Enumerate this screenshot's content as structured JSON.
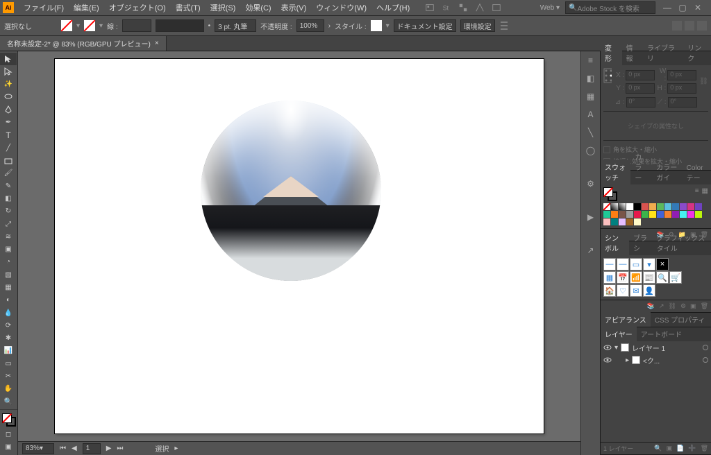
{
  "app": {
    "icon_label": "Ai",
    "menus": [
      "ファイル(F)",
      "編集(E)",
      "オブジェクト(O)",
      "書式(T)",
      "選択(S)",
      "効果(C)",
      "表示(V)",
      "ウィンドウ(W)",
      "ヘルプ(H)"
    ],
    "workspace": "Web",
    "search_placeholder": "Adobe Stock を検索"
  },
  "control": {
    "selection_label": "選択なし",
    "stroke_label": "線 :",
    "stroke_weight": "",
    "stroke_preset": "3 pt. 丸筆",
    "opacity_label": "不透明度 :",
    "opacity_value": "100%",
    "style_label": "スタイル :",
    "doc_setup": "ドキュメント設定",
    "env_setup": "環境設定"
  },
  "tab": {
    "title": "名称未設定-2* @ 83% (RGB/GPU プレビュー)"
  },
  "status": {
    "zoom": "83%",
    "page": "1",
    "tool": "選択"
  },
  "panels": {
    "transform": {
      "tabs": [
        "変形",
        "情報",
        "ライブラリ",
        "リンク"
      ],
      "x_label": "X :",
      "x": "0 px",
      "y_label": "Y :",
      "y": "0 px",
      "w_label": "W :",
      "w": "0 px",
      "h_label": "H :",
      "h": "0 px",
      "angle_label": "⊿ :",
      "angle": "0°",
      "shear_label": "⟋ :",
      "shear": "0°",
      "no_shape": "シェイプの属性なし",
      "check1": "角を拡大・縮小",
      "check2": "線幅と効果を拡大・縮小"
    },
    "swatches": {
      "tabs": [
        "スウォッチ",
        "カラー",
        "カラーガイ",
        "Color テー"
      ]
    },
    "symbols": {
      "tabs": [
        "シンボル",
        "ブラシ",
        "グラフィックスタイル"
      ]
    },
    "appearance": {
      "tabs": [
        "アピアランス",
        "CSS プロパティ"
      ]
    },
    "layers": {
      "tabs": [
        "レイヤー",
        "アートボード"
      ],
      "items": [
        {
          "name": "レイヤー 1"
        },
        {
          "name": "<ク..."
        }
      ],
      "footer": "1 レイヤー"
    }
  },
  "swatch_colors": [
    [
      "#ffffff",
      "#000000",
      "#d9534f",
      "#f0ad4e",
      "#5cb85c",
      "#5bc0de",
      "#337ab7",
      "#8a4bcb",
      "#d63384",
      "#6f42c1",
      "#20c997",
      "#fd7e14",
      "#795548",
      "#9e9e9e"
    ],
    [
      "#e6194b",
      "#3cb44b",
      "#ffe119",
      "#4363d8",
      "#f58231",
      "#911eb4",
      "#46f0f0",
      "#f032e6",
      "#bcf60c",
      "#fabebe",
      "#008080",
      "#e6beff",
      "#9a6324",
      "#fffac8"
    ]
  ]
}
